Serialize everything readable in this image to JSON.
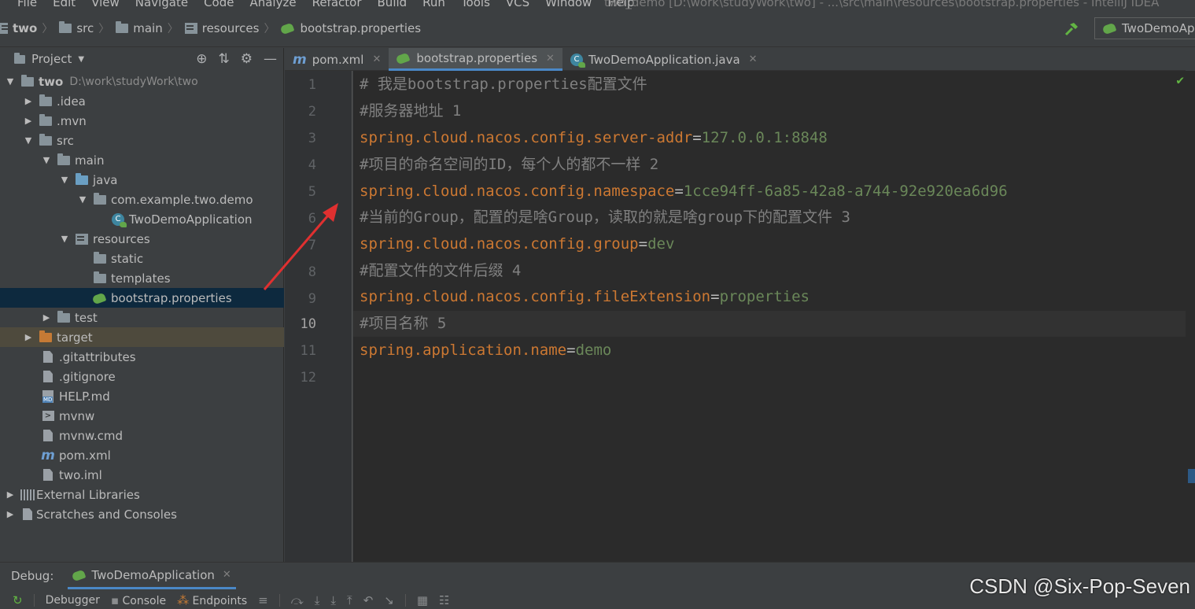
{
  "menubar": {
    "items": [
      "File",
      "Edit",
      "View",
      "Navigate",
      "Code",
      "Analyze",
      "Refactor",
      "Build",
      "Run",
      "Tools",
      "VCS",
      "Window",
      "Help"
    ],
    "window_title": "two_demo [D:\\work\\studyWork\\two] - ...\\src\\main\\resources\\bootstrap.properties - IntelliJ IDEA"
  },
  "breadcrumb": {
    "items": [
      "two",
      "src",
      "main",
      "resources",
      "bootstrap.properties"
    ]
  },
  "run_config": {
    "label": "TwoDemoAp"
  },
  "project_panel": {
    "title": "Project",
    "tree": [
      {
        "label": "two",
        "path": "D:\\work\\studyWork\\two"
      },
      {
        "label": ".idea"
      },
      {
        "label": ".mvn"
      },
      {
        "label": "src"
      },
      {
        "label": "main"
      },
      {
        "label": "java"
      },
      {
        "label": "com.example.two.demo"
      },
      {
        "label": "TwoDemoApplication"
      },
      {
        "label": "resources"
      },
      {
        "label": "static"
      },
      {
        "label": "templates"
      },
      {
        "label": "bootstrap.properties"
      },
      {
        "label": "test"
      },
      {
        "label": "target"
      },
      {
        "label": ".gitattributes"
      },
      {
        "label": ".gitignore"
      },
      {
        "label": "HELP.md"
      },
      {
        "label": "mvnw"
      },
      {
        "label": "mvnw.cmd"
      },
      {
        "label": "pom.xml"
      },
      {
        "label": "two.iml"
      },
      {
        "label": "External Libraries"
      },
      {
        "label": "Scratches and Consoles"
      }
    ]
  },
  "tabs": [
    {
      "label": "pom.xml",
      "active": false
    },
    {
      "label": "bootstrap.properties",
      "active": true
    },
    {
      "label": "TwoDemoApplication.java",
      "active": false
    }
  ],
  "editor": {
    "current_line": 10,
    "line_numbers": [
      "1",
      "2",
      "3",
      "4",
      "5",
      "6",
      "7",
      "8",
      "9",
      "10",
      "11",
      "12"
    ],
    "lines": [
      {
        "comment": "# 我是bootstrap.properties配置文件"
      },
      {
        "comment": "#服务器地址 1"
      },
      {
        "key": "spring.cloud.nacos.config.server-addr",
        "value": "127.0.0.1:8848"
      },
      {
        "comment": "#项目的命名空间的ID，每个人的都不一样 2"
      },
      {
        "key": "spring.cloud.nacos.config.namespace",
        "value": "1cce94ff-6a85-42a8-a744-92e920ea6d96"
      },
      {
        "comment": "#当前的Group，配置的是啥Group，读取的就是啥group下的配置文件 3"
      },
      {
        "key": "spring.cloud.nacos.config.group",
        "value": "dev"
      },
      {
        "comment": "#配置文件的文件后缀 4"
      },
      {
        "key": "spring.cloud.nacos.config.fileExtension",
        "value": "properties"
      },
      {
        "comment": "#项目名称 5"
      },
      {
        "key": "spring.application.name",
        "value": "demo"
      }
    ],
    "equals": "="
  },
  "debug_panel": {
    "label": "Debug:",
    "tab": "TwoDemoApplication",
    "toolbar": [
      "Debugger",
      "Console",
      "Endpoints"
    ]
  },
  "watermark": "CSDN @Six-Pop-Seven",
  "colors": {
    "keyword": "#cc7832",
    "string_value": "#6a8759",
    "comment": "#808080",
    "selection": "#0d293e",
    "accent": "#4a88c7"
  }
}
